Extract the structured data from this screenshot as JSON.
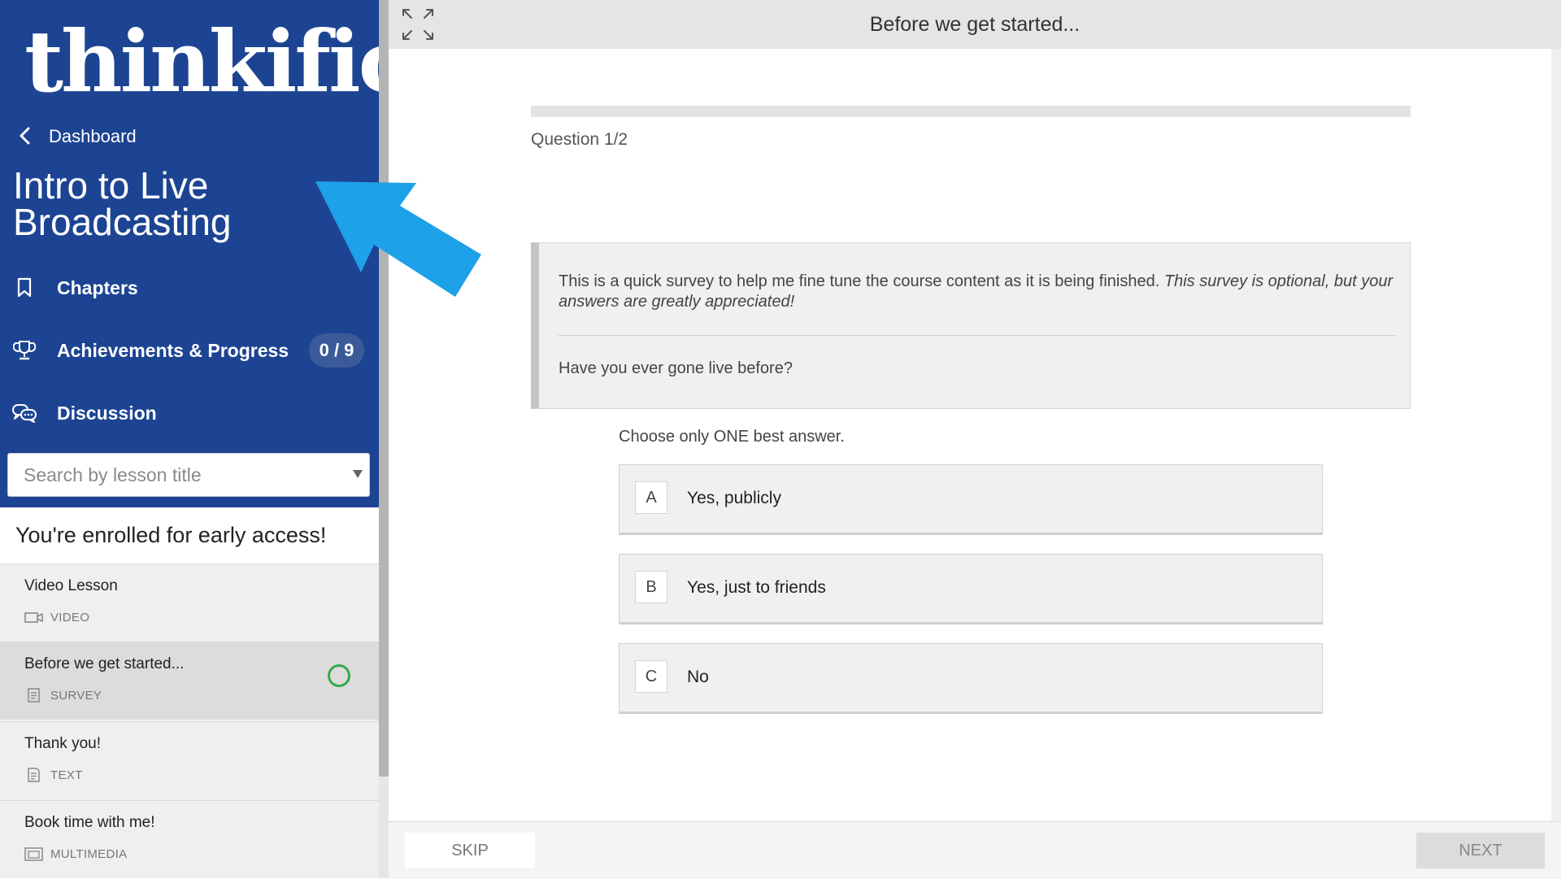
{
  "colors": {
    "sidebar_blue": "#1d4493",
    "pill_blue": "#3b5a9a",
    "complete_green": "#37a94a",
    "annotation_arrow": "#1da1e8"
  },
  "sidebar": {
    "logo": "thinkific",
    "back_label": "Dashboard",
    "back_icon": "chevron-left-icon",
    "course_title": "Intro to Live Broadcasting",
    "nav": {
      "chapters": {
        "label": "Chapters",
        "icon": "bookmark-icon"
      },
      "achievements": {
        "label": "Achievements & Progress",
        "icon": "trophy-icon",
        "progress": "0 / 9"
      },
      "discussion": {
        "label": "Discussion",
        "icon": "chat-bubbles-icon"
      }
    },
    "search": {
      "placeholder": "Search by lesson title",
      "value": ""
    },
    "enrolled_banner": "You're enrolled for early access!",
    "lessons": [
      {
        "title": "Video Lesson",
        "type": "VIDEO",
        "icon": "video-camera-icon",
        "active": false,
        "completed": false
      },
      {
        "title": "Before we get started...",
        "type": "SURVEY",
        "icon": "survey-icon",
        "active": true,
        "completed": false
      },
      {
        "title": "Thank you!",
        "type": "TEXT",
        "icon": "text-document-icon",
        "active": false,
        "completed": false
      },
      {
        "title": "Book time with me!",
        "type": "MULTIMEDIA",
        "icon": "multimedia-icon",
        "active": false,
        "completed": false
      }
    ]
  },
  "main": {
    "expand_icon": "expand-arrows-icon",
    "page_title": "Before we get started...",
    "question_counter": "Question 1/2",
    "survey_intro": "This is a quick survey to help me fine tune the course content as it is being finished.",
    "survey_intro_italic": "This survey is optional, but your answers are greatly appreciated!",
    "question_text": "Have you ever gone live before?",
    "hint": "Choose only ONE best answer.",
    "options": [
      {
        "letter": "A",
        "text": "Yes, publicly"
      },
      {
        "letter": "B",
        "text": "Yes, just to friends"
      },
      {
        "letter": "C",
        "text": "No"
      }
    ],
    "footer": {
      "skip_label": "SKIP",
      "next_label": "NEXT"
    }
  }
}
